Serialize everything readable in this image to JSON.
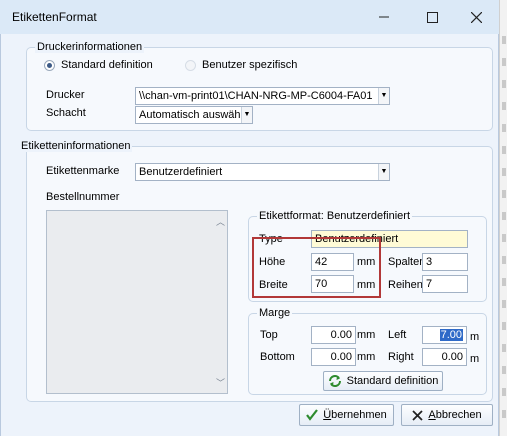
{
  "window": {
    "title": "EtikettenFormat",
    "min_icon": "minimize-icon",
    "max_icon": "maximize-icon",
    "close_icon": "close-icon"
  },
  "printer_info": {
    "legend": "Druckerinformationen",
    "radio_standard": "Standard definition",
    "radio_user": "Benutzer spezifisch",
    "selected": "Standard definition",
    "printer_label": "Drucker",
    "printer_value": "\\\\chan-vm-print01\\CHAN-NRG-MP-C6004-FA01",
    "tray_label": "Schacht",
    "tray_value": "Automatisch auswähl"
  },
  "label_info": {
    "legend": "Etiketteninformationen",
    "brand_label": "Etikettenmarke",
    "brand_value": "Benutzerdefiniert",
    "order_label": "Bestellnummer"
  },
  "format": {
    "legend": "Etikettformat: Benutzerdefiniert",
    "type_label": "Type",
    "type_value": "Benutzerdefiniert",
    "height_label": "Höhe",
    "height_value": "42",
    "height_unit": "mm",
    "width_label": "Breite",
    "width_value": "70",
    "width_unit": "mm",
    "columns_label": "Spalten",
    "columns_value": "3",
    "rows_label": "Reihen",
    "rows_value": "7"
  },
  "margin": {
    "legend": "Marge",
    "top_label": "Top",
    "top_value": "0.00",
    "top_unit": "mm",
    "left_label": "Left",
    "left_value": "7.00",
    "left_unit": "m",
    "bottom_label": "Bottom",
    "bottom_value": "0.00",
    "bottom_unit": "mm",
    "right_label": "Right",
    "right_value": "0.00",
    "right_unit": "m",
    "standard_button": "Standard definition"
  },
  "footer": {
    "apply_prefix": "",
    "apply_underline": "Ü",
    "apply_rest": "bernehmen",
    "cancel_underline": "A",
    "cancel_rest": "bbrechen"
  },
  "colors": {
    "accent": "#2f6ac8",
    "highlight": "#b23838",
    "type_field_bg": "#fffbd6"
  }
}
